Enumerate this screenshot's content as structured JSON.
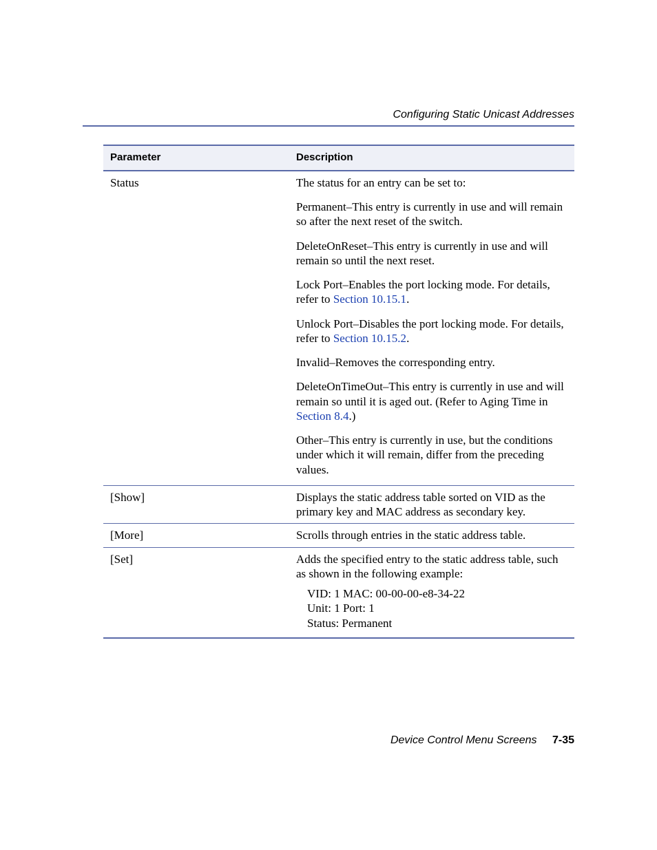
{
  "header": {
    "section_title": "Configuring Static Unicast Addresses"
  },
  "table": {
    "columns": {
      "param": "Parameter",
      "desc": "Description"
    },
    "rows": {
      "status": {
        "param": "Status",
        "intro": "The status for an entry can be set to:",
        "permanent": "Permanent–This entry is currently in use and will remain so after the next reset of the switch.",
        "delete_on_reset": "DeleteOnReset–This entry is currently in use and will remain so until the next reset.",
        "lock_port_pre": "Lock Port–Enables the port locking mode. For details, refer to ",
        "lock_port_link": "Section 10.15.1",
        "lock_port_post": ".",
        "unlock_port_pre": "Unlock Port–Disables the port locking mode. For details, refer to ",
        "unlock_port_link": "Section 10.15.2",
        "unlock_port_post": ".",
        "invalid": "Invalid–Removes the corresponding entry.",
        "delete_timeout_pre": "DeleteOnTimeOut–This entry is currently in use and will remain so until it is aged out. (Refer to Aging Time in ",
        "delete_timeout_link": "Section 8.4",
        "delete_timeout_post": ".)",
        "other": "Other–This entry is currently in use, but the conditions under which it will remain, differ from the preceding values."
      },
      "show": {
        "param": "[Show]",
        "desc": "Displays the static address table sorted on VID as the primary key and MAC address as secondary key."
      },
      "more": {
        "param": "[More]",
        "desc": "Scrolls through entries in the static address table."
      },
      "set": {
        "param": "[Set]",
        "desc": "Adds the specified entry to the static address table, such as shown in the following example:",
        "example_l1": "VID: 1 MAC: 00-00-00-e8-34-22",
        "example_l2": "Unit: 1 Port: 1",
        "example_l3": "Status: Permanent"
      }
    }
  },
  "footer": {
    "title": "Device Control Menu Screens",
    "page": "7-35"
  }
}
